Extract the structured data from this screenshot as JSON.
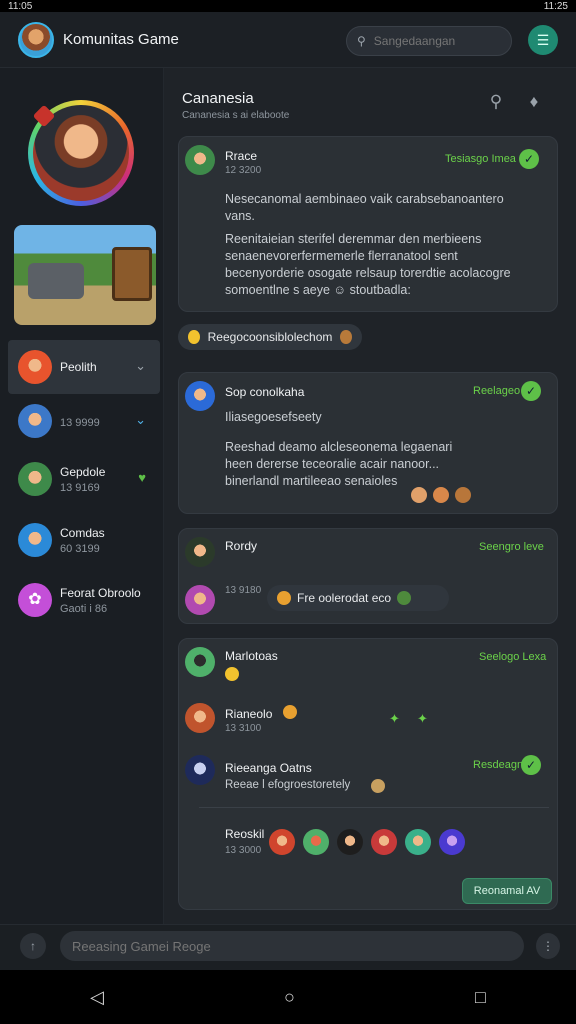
{
  "status_bar": {
    "left": "11:05",
    "right": "11:25"
  },
  "topbar": {
    "title": "Komunitas Game",
    "search_placeholder": "Sangedaangan"
  },
  "sidebar": {
    "contacts": [
      {
        "name": "Peolith",
        "sub": ""
      },
      {
        "name": "",
        "sub": "13 9999"
      },
      {
        "name": "Gepdole",
        "sub": "13 9169"
      },
      {
        "name": "Comdas",
        "sub": "60 3199"
      },
      {
        "name": "Feorat Obroolo",
        "sub": "Gaoti i 86"
      }
    ]
  },
  "channel": {
    "title": "Cananesia",
    "subtitle": "Cananesia s ai elaboote"
  },
  "messages": [
    {
      "name": "Rrace",
      "time": "12 3200",
      "meta": "Tesiasgo Imea",
      "body1": "Nesecanomal aembinaeo vaik carabsebanoantero vans.",
      "body2": "Reenitaieian sterifel deremmar den merbieens senaenevorerfermemerle flerranatool sent becenyorderie osogate relsaup torerdtie acolacogre somoentlne s aeye ☺ stoutbadla:"
    },
    {
      "pill": "Reegocoonsiblolechom"
    },
    {
      "name": "Sop conolkaha",
      "meta": "Reelageo",
      "sub": "Iliasegoesefseety",
      "body": "Reeshad deamo alcleseonema legaenari heen dererse teceoralie acair nanoor... binerlandl martileeao senaioles"
    },
    {
      "name": "Rordy",
      "time": "13 9180",
      "meta": "Seengro leve",
      "reply_line": "Fre oolerodat eco"
    },
    {
      "name": "Marlotoas",
      "meta": "Seelogo Lexa",
      "sub_name": "Rianeolo",
      "sub_time": "13 3100",
      "third_name": "Rieeanga Oatns",
      "third_sub": "Reeae l efogroestoretely",
      "meta2": "Resdeagne",
      "fourth_name": "Reoskil",
      "fourth_time": "13 3000"
    }
  ],
  "reply_button": "Reonamal AV",
  "composer": {
    "placeholder": "Reeasing Gamei Reoge"
  },
  "colors": {
    "accent": "#1f8a72",
    "online": "#5ec048",
    "meta": "#6bd24a"
  }
}
